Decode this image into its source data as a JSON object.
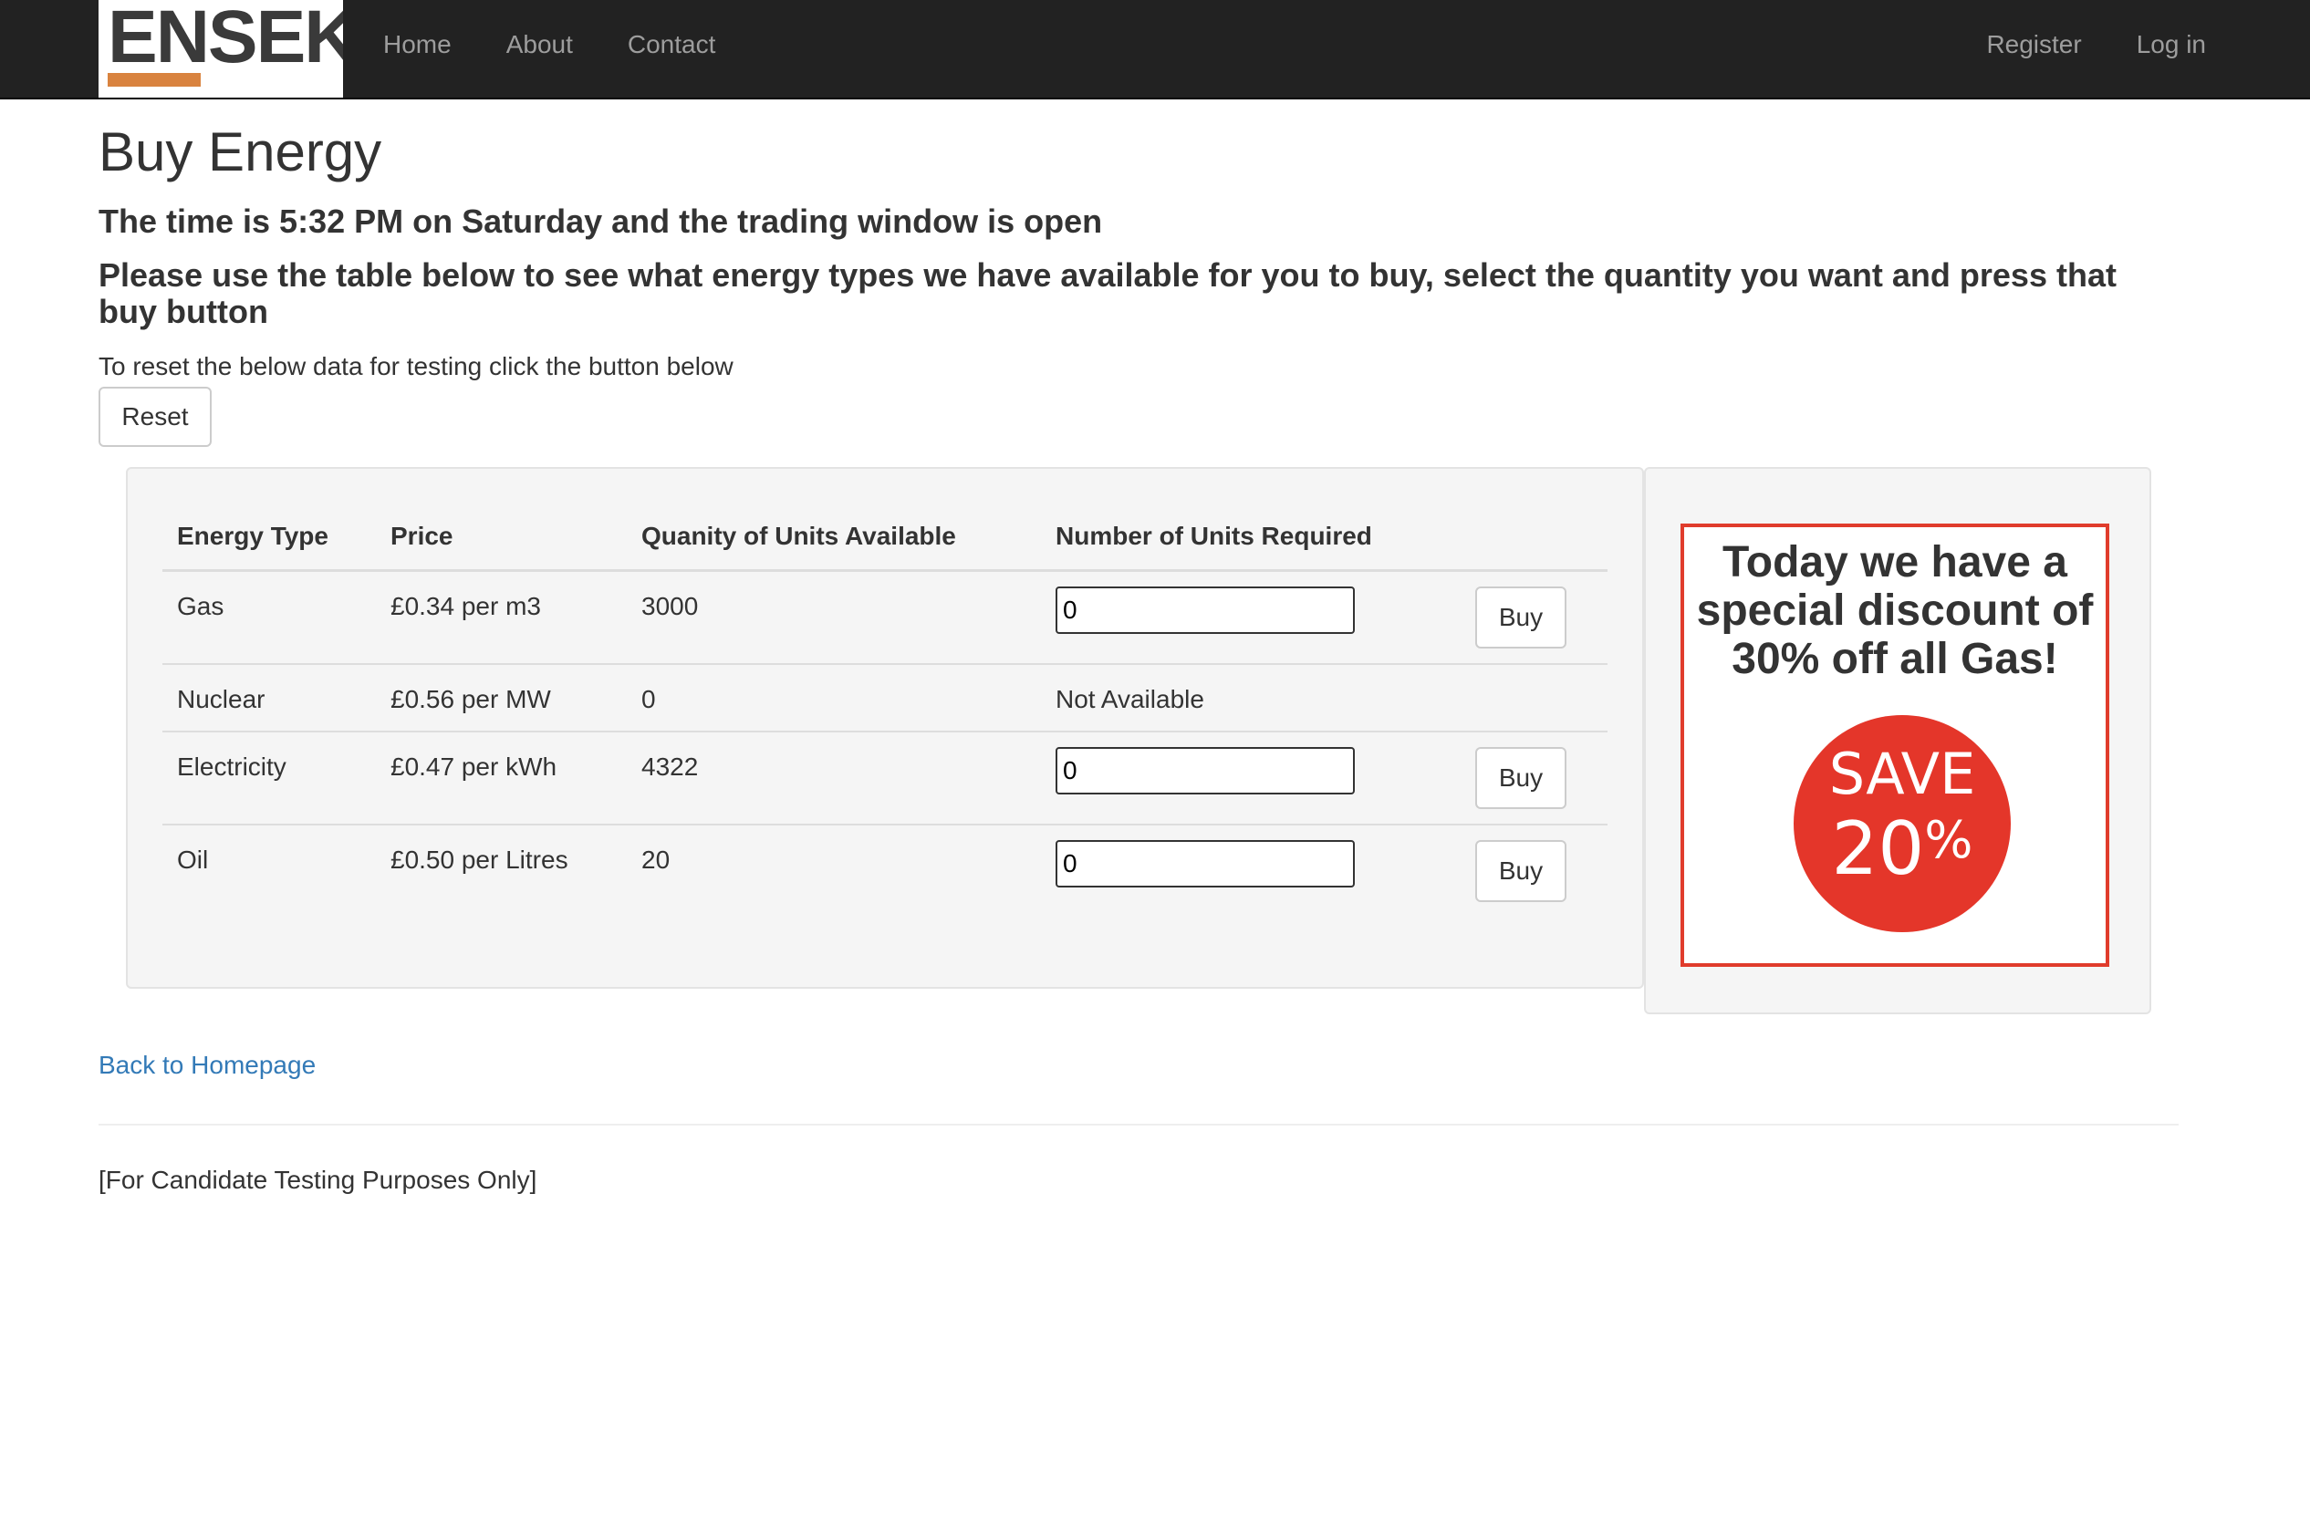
{
  "navbar": {
    "brand": "ENSEK",
    "left_links": [
      "Home",
      "About",
      "Contact"
    ],
    "right_links": [
      "Register",
      "Log in"
    ]
  },
  "page": {
    "title": "Buy Energy",
    "time_line": "The time is 5:32 PM on Saturday and the trading window is open",
    "instructions": "Please use the table below to see what energy types we have available for you to buy, select the quantity you want and press that buy button",
    "reset_text": "To reset the below data for testing click the button below",
    "reset_label": "Reset"
  },
  "table": {
    "headers": [
      "Energy Type",
      "Price",
      "Quanity of Units Available",
      "Number of Units Required",
      ""
    ],
    "rows": [
      {
        "type": "Gas",
        "price": "£0.34 per m3",
        "available": "3000",
        "required": "0",
        "buy_label": "Buy"
      },
      {
        "type": "Nuclear",
        "price": "£0.56 per MW",
        "available": "0",
        "status": "Not Available"
      },
      {
        "type": "Electricity",
        "price": "£0.47 per kWh",
        "available": "4322",
        "required": "0",
        "buy_label": "Buy"
      },
      {
        "type": "Oil",
        "price": "£0.50 per Litres",
        "available": "20",
        "required": "0",
        "buy_label": "Buy"
      }
    ]
  },
  "promo": {
    "text": "Today we have a special discount of 30% off all Gas!",
    "badge_word": "SAVE",
    "badge_number": "20",
    "badge_symbol": "%"
  },
  "footer": {
    "back_link": "Back to Homepage",
    "note": "[For Candidate Testing Purposes Only]"
  }
}
